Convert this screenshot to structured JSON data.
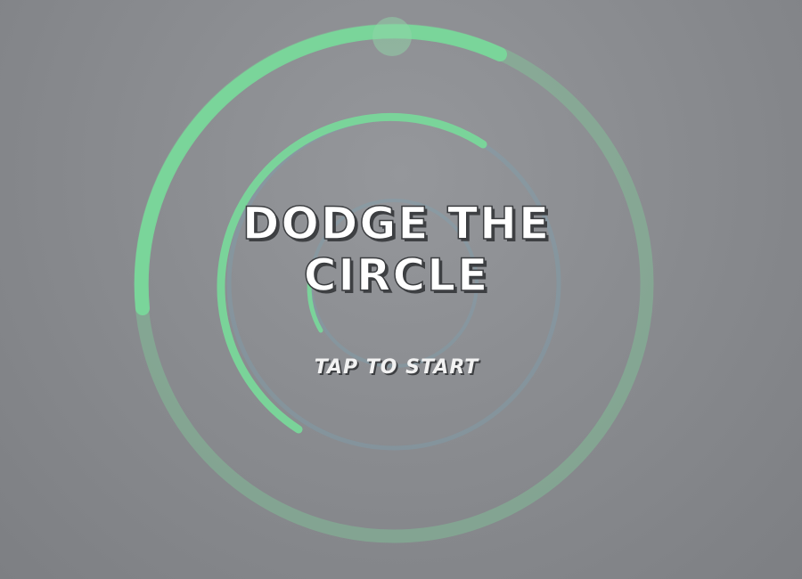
{
  "game": {
    "title_line1": "DODGE THE",
    "title_line2": "CIRCLE",
    "start_prompt": "TAP TO START"
  },
  "colors": {
    "background": "#8a8c90",
    "ring_green": "#79d79a",
    "ring_track": "#80c89a",
    "inner_ring_blue": "#7aa3b5",
    "title_text": "#ffffff",
    "text_outline": "#3b3d40"
  },
  "scene": {
    "outer_ring_arc_share": 0.3,
    "middle_ring_arc_share": 0.42,
    "inner_ring_arc_share": 0.12,
    "marker": "player-dot"
  }
}
